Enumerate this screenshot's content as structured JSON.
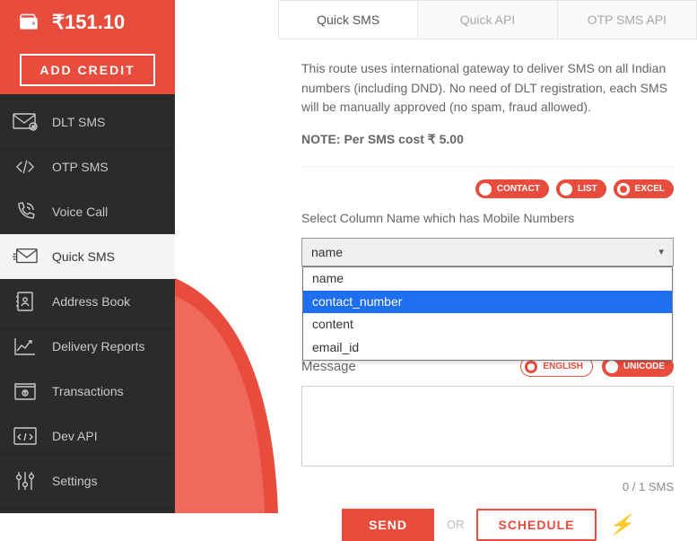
{
  "wallet": {
    "amount": "₹151.10",
    "add_credit": "ADD CREDIT"
  },
  "nav": {
    "items": [
      {
        "label": "DLT SMS"
      },
      {
        "label": "OTP SMS"
      },
      {
        "label": "Voice Call"
      },
      {
        "label": "Quick SMS"
      },
      {
        "label": "Address Book"
      },
      {
        "label": "Delivery Reports"
      },
      {
        "label": "Transactions"
      },
      {
        "label": "Dev API"
      },
      {
        "label": "Settings"
      }
    ]
  },
  "tabs": {
    "quick_sms": "Quick SMS",
    "quick_api": "Quick API",
    "otp_api": "OTP SMS API"
  },
  "info": {
    "text": "This route uses international gateway to deliver SMS on all Indian numbers (including DND). No need of DLT registration, each SMS will be manually approved (no spam, fraud allowed).",
    "note": "NOTE: Per SMS cost ₹ 5.00"
  },
  "source_pills": {
    "contact": "CONTACT",
    "list": "LIST",
    "excel": "EXCEL"
  },
  "column": {
    "label": "Select Column Name which has Mobile Numbers",
    "selected": "name",
    "options": {
      "o0": "name",
      "o1": "contact_number",
      "o2": "content",
      "o3": "email_id"
    }
  },
  "message": {
    "label": "Message",
    "pills": {
      "english": "ENGLISH",
      "unicode": "UNICODE"
    },
    "counter": "0 / 1 SMS"
  },
  "actions": {
    "send": "SEND",
    "or": "OR",
    "schedule": "SCHEDULE"
  }
}
